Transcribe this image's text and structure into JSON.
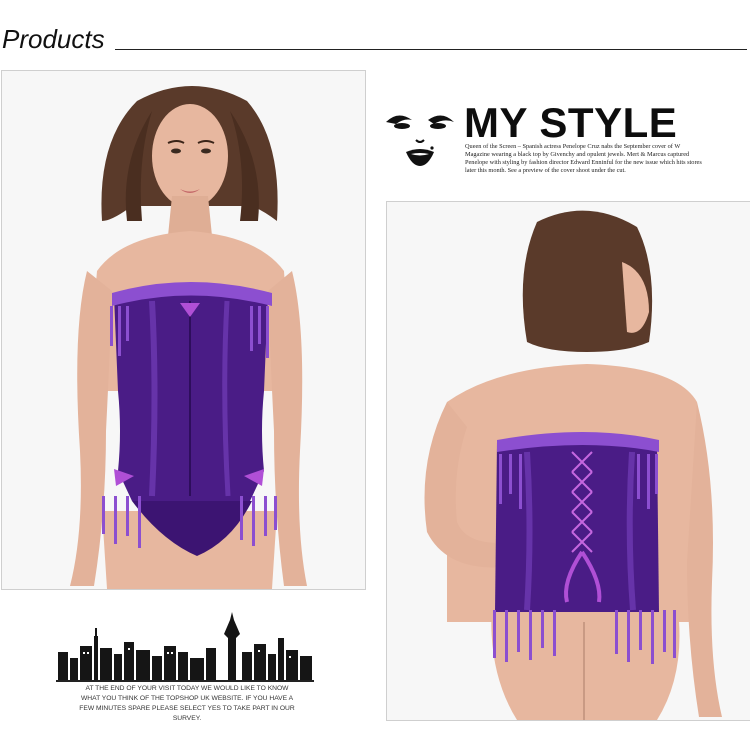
{
  "header": {
    "title": "Products"
  },
  "my_style": {
    "heading": "MY STYLE",
    "body": "Queen of the Screen – Spanish actress Penelope Cruz nabs the September cover of W Magazine wearing a black top by Givenchy and opulent jewels. Mert & Marcus captured Penelope with styling by fashion director Edward Enninful for the new issue which hits stores later this month. See a preview of the cover shoot under the cut."
  },
  "skyline": {
    "text": "AT THE END OF YOUR VISIT TODAY WE WOULD LIKE TO KNOW WHAT YOU THINK OF THE TOPSHOP UK WEBSITE. IF YOU HAVE A FEW MINUTES SPARE PLEASE SELECT YES TO TAKE PART IN OUR SURVEY."
  },
  "colors": {
    "corset_purple": "#4a1c86",
    "corset_highlight": "#7a43c2",
    "ruffle_violet": "#8c4fd0",
    "ribbon_pink": "#b04fd6",
    "skin": "#e7b79f",
    "hair": "#5a3a2a",
    "background": "#f6f6f6"
  }
}
